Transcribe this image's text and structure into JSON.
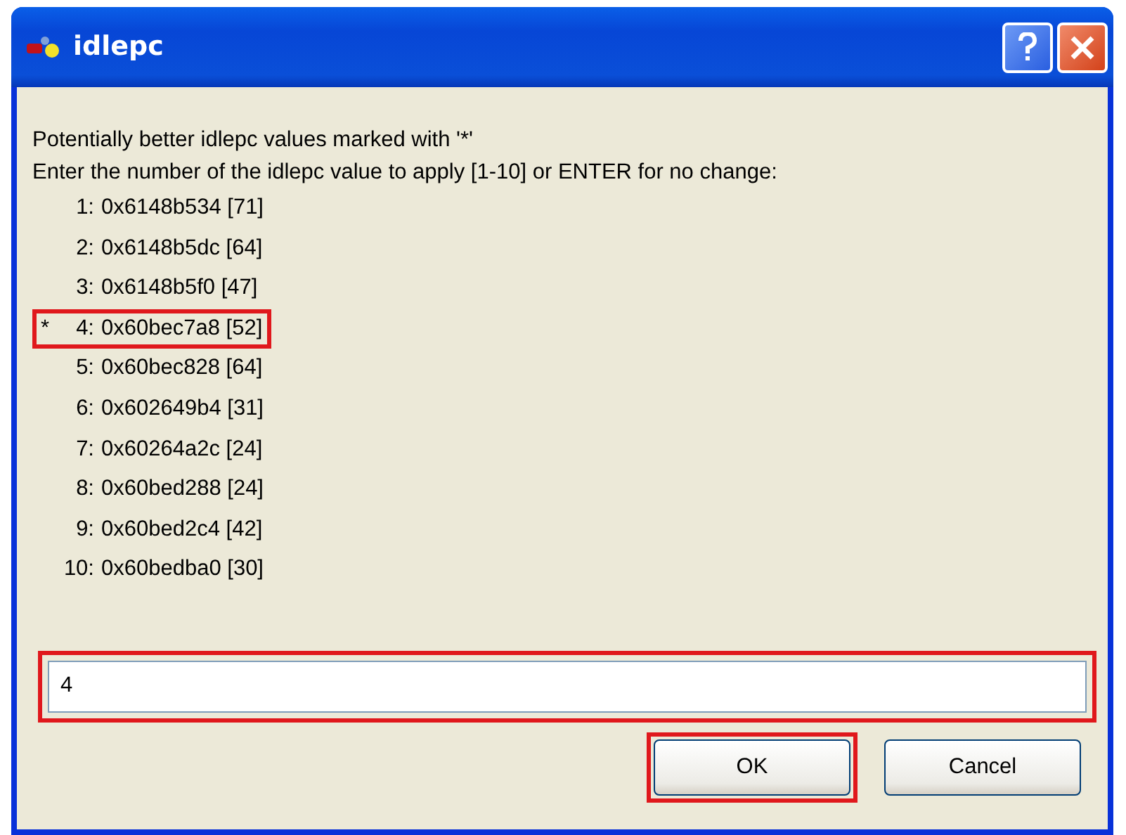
{
  "window": {
    "title": "idlepc"
  },
  "message": [
    "Potentially better idlepc values marked with '*'",
    "Enter the number of the idlepc value to apply [1-10] or ENTER for no change:"
  ],
  "entries": [
    {
      "index": "1:",
      "value": "0x6148b534 [71]",
      "highlighted": false
    },
    {
      "index": "2:",
      "value": "0x6148b5dc [64]",
      "highlighted": false
    },
    {
      "index": "3:",
      "value": "0x6148b5f0 [47]",
      "highlighted": false
    },
    {
      "marker": "*",
      "index": "4:",
      "value": "0x60bec7a8 [52]",
      "highlighted": true
    },
    {
      "index": "5:",
      "value": "0x60bec828 [64]",
      "highlighted": false
    },
    {
      "index": "6:",
      "value": "0x602649b4 [31]",
      "highlighted": false
    },
    {
      "index": "7:",
      "value": "0x60264a2c [24]",
      "highlighted": false
    },
    {
      "index": "8:",
      "value": "0x60bed288 [24]",
      "highlighted": false
    },
    {
      "index": "9:",
      "value": "0x60bed2c4 [42]",
      "highlighted": false
    },
    {
      "index": "10:",
      "value": "0x60bedba0 [30]",
      "highlighted": false
    }
  ],
  "input": {
    "value": "4",
    "highlighted": true
  },
  "buttons": [
    {
      "label": "OK",
      "highlighted": true
    },
    {
      "label": "Cancel",
      "highlighted": false
    }
  ]
}
